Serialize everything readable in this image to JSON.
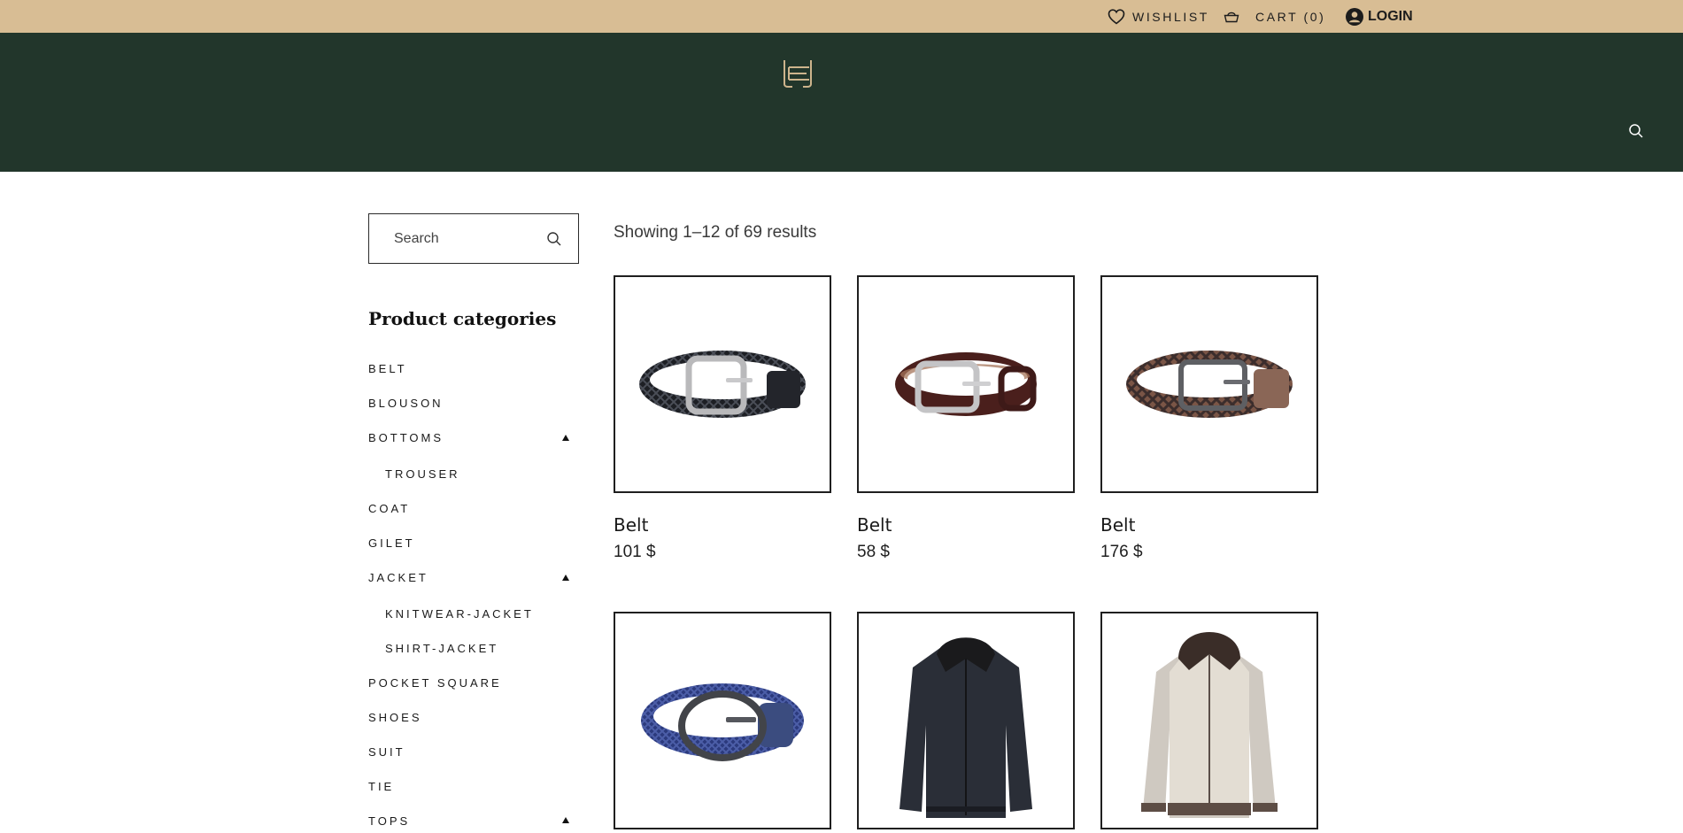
{
  "topbar": {
    "wishlist_label": "WISHLIST",
    "cart_label": "CART (0)",
    "login_label": "LOGIN"
  },
  "header": {
    "logo_icon": "brand-logo-icon",
    "search_icon": "search-icon"
  },
  "sidebar": {
    "search_placeholder": "Search",
    "categories_title": "Product categories",
    "categories": [
      {
        "label": "BELT"
      },
      {
        "label": "BLOUSON"
      },
      {
        "label": "BOTTOMS",
        "expanded": true
      },
      {
        "label": "TROUSER",
        "sub": true
      },
      {
        "label": "COAT"
      },
      {
        "label": "GILET"
      },
      {
        "label": "JACKET",
        "expanded": true
      },
      {
        "label": "KNITWEAR-JACKET",
        "sub": true
      },
      {
        "label": "SHIRT-JACKET",
        "sub": true
      },
      {
        "label": "POCKET SQUARE"
      },
      {
        "label": "SHOES"
      },
      {
        "label": "SUIT"
      },
      {
        "label": "TIE"
      },
      {
        "label": "TOPS",
        "expanded": true
      }
    ]
  },
  "main": {
    "results_text": "Showing 1–12 of 69 results",
    "products": [
      {
        "name": "Belt",
        "price": "101 $",
        "image": "black-braided-belt"
      },
      {
        "name": "Belt",
        "price": "58 $",
        "image": "brown-leather-belt"
      },
      {
        "name": "Belt",
        "price": "176 $",
        "image": "brown-suede-braided-belt"
      },
      {
        "name": "",
        "price": "",
        "image": "navy-elastic-belt"
      },
      {
        "name": "",
        "price": "",
        "image": "black-bomber-jacket"
      },
      {
        "name": "",
        "price": "",
        "image": "beige-hooded-jacket"
      }
    ]
  },
  "colors": {
    "topbar_bg": "#d8bd94",
    "header_bg": "#22362b",
    "logo": "#cdb48c"
  }
}
